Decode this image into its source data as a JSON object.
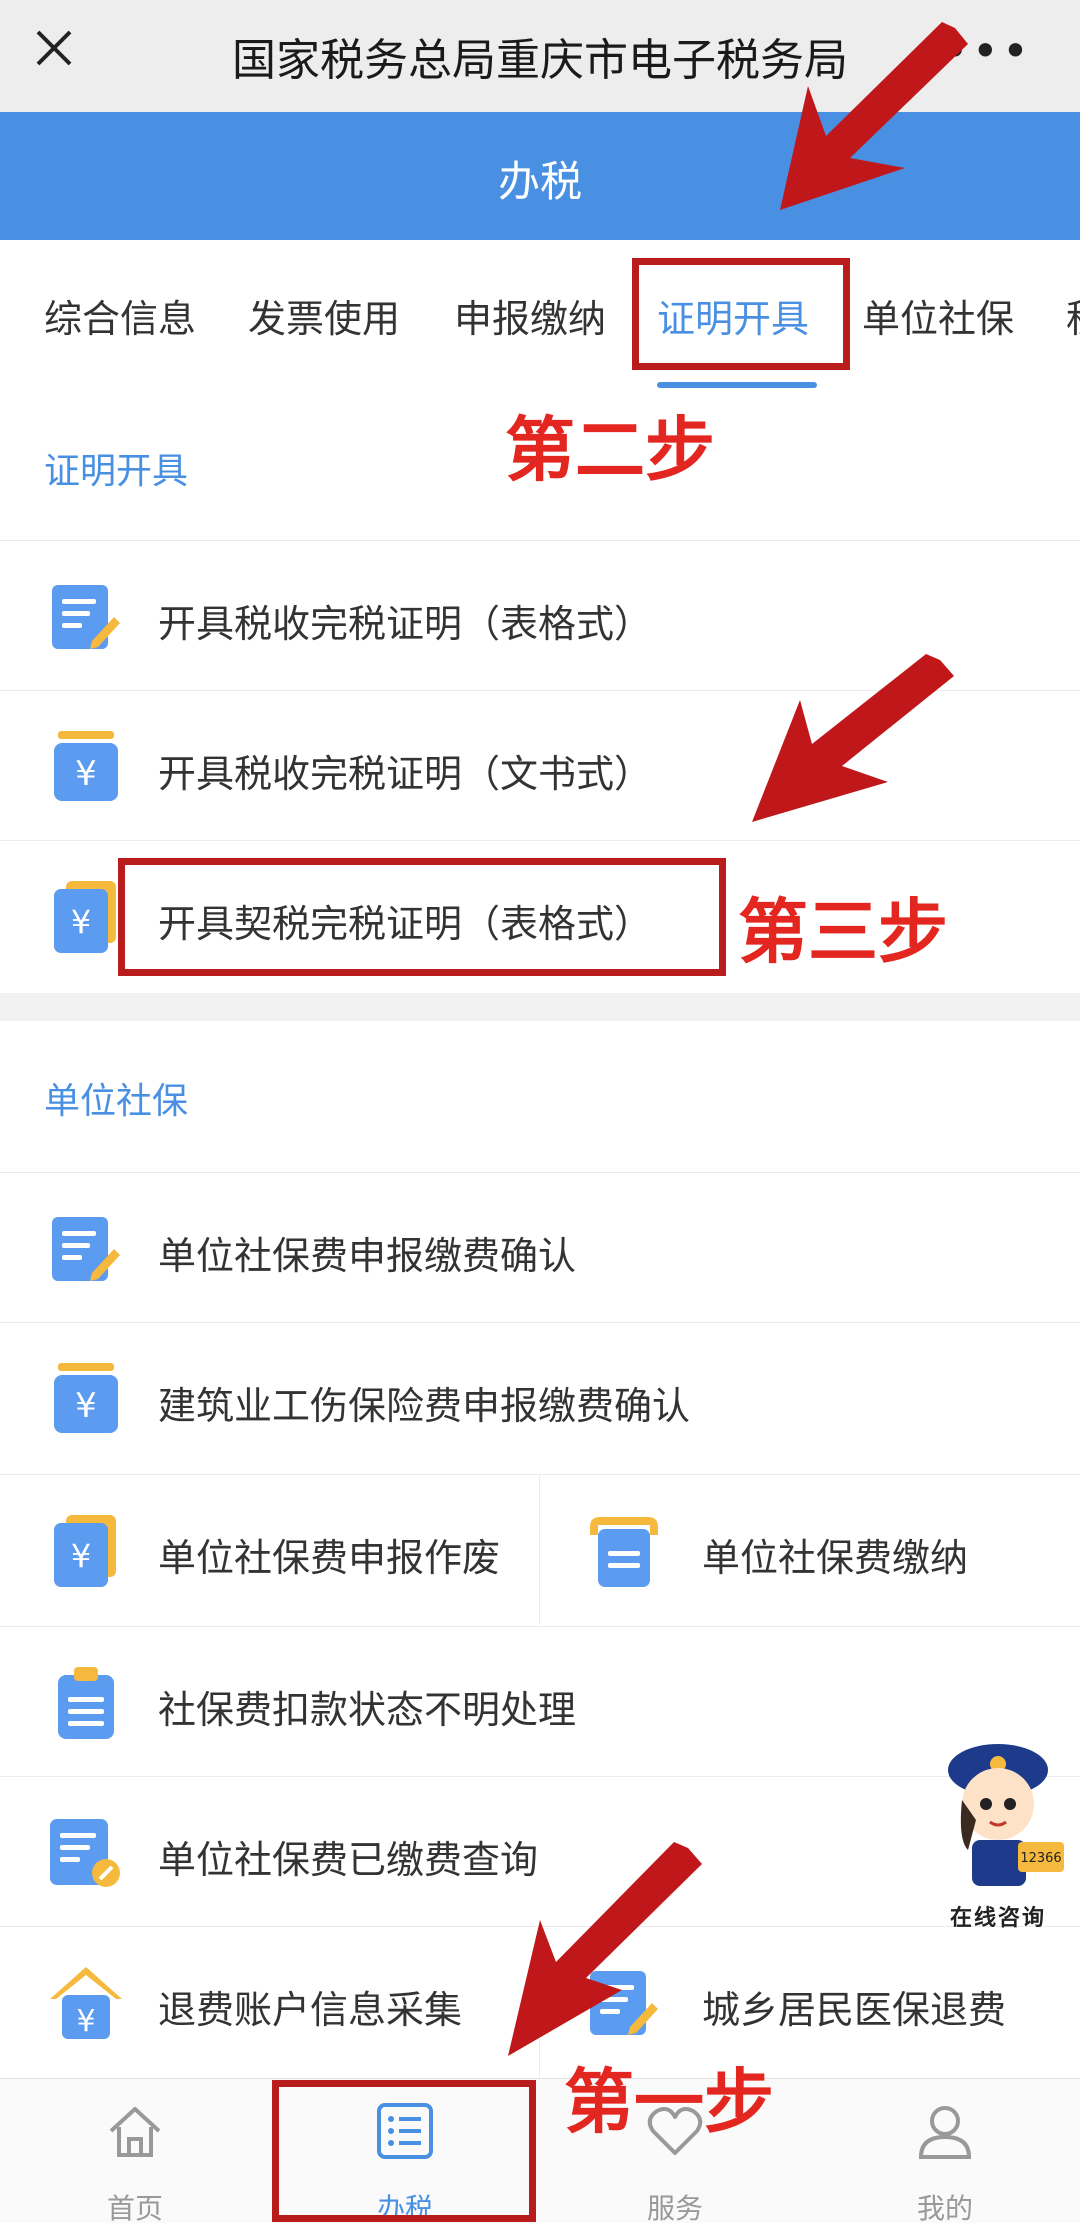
{
  "window": {
    "title": "国家税务总局重庆市电子税务局",
    "more": "•••"
  },
  "header": {
    "title": "办税"
  },
  "tabs": [
    {
      "label": "综合信息"
    },
    {
      "label": "发票使用"
    },
    {
      "label": "申报缴纳"
    },
    {
      "label": "证明开具",
      "active": true
    },
    {
      "label": "单位社保"
    },
    {
      "label": "税"
    }
  ],
  "sections": [
    {
      "title": "证明开具",
      "items": [
        {
          "label": "开具税收完税证明（表格式）",
          "icon": "form-edit-icon"
        },
        {
          "label": "开具税收完税证明（文书式）",
          "icon": "yen-doc-icon"
        },
        {
          "label": "开具契税完税证明（表格式）",
          "icon": "yen-card-icon"
        }
      ]
    },
    {
      "title": "单位社保",
      "items": [
        {
          "label": "单位社保费申报缴费确认",
          "icon": "form-edit-icon"
        },
        {
          "label": "建筑业工伤保险费申报缴费确认",
          "icon": "yen-doc-icon"
        },
        {
          "label": "单位社保费申报作废",
          "icon": "yen-card-icon"
        },
        {
          "label": "单位社保费缴纳",
          "icon": "doc-list-icon"
        },
        {
          "label": "社保费扣款状态不明处理",
          "icon": "clipboard-icon"
        },
        {
          "label": "单位社保费已缴费查询",
          "icon": "doc-query-icon"
        },
        {
          "label": "退费账户信息采集",
          "icon": "house-yen-icon"
        },
        {
          "label": "城乡居民医保退费",
          "icon": "form-edit-icon"
        }
      ]
    }
  ],
  "bottom_nav": [
    {
      "label": "首页",
      "icon": "home-icon"
    },
    {
      "label": "办税",
      "icon": "list-icon",
      "active": true
    },
    {
      "label": "服务",
      "icon": "heart-icon"
    },
    {
      "label": "我的",
      "icon": "user-icon"
    }
  ],
  "annotations": {
    "step1": "第一步",
    "step2": "第二步",
    "step3": "第三步"
  },
  "mascot": {
    "label": "在线咨询",
    "badge": "12366"
  },
  "colors": {
    "accent": "#4a90e2",
    "annotation_red": "#e3261f",
    "box_red": "#b91c1c"
  }
}
